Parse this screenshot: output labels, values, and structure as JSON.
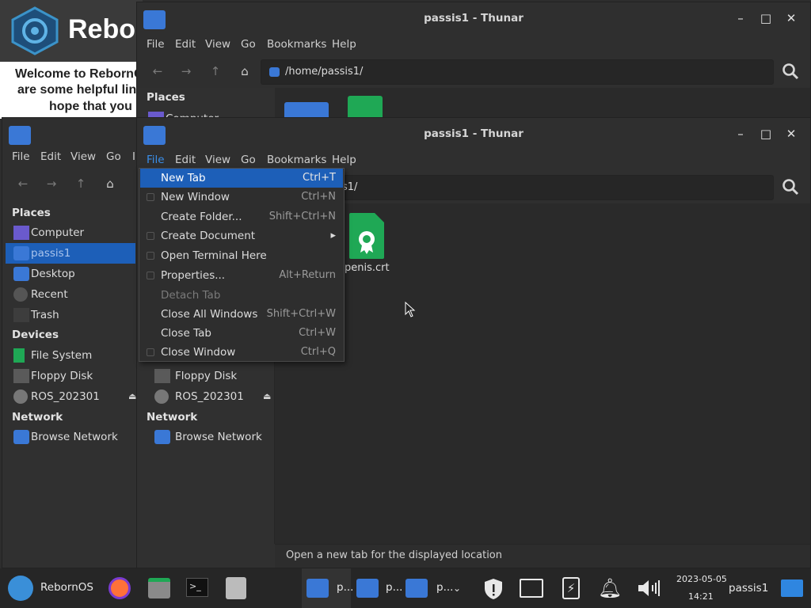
{
  "welcome": {
    "brand": "Rebor",
    "line1": "Welcome to RebornO",
    "line2": "are some helpful links",
    "line3": "hope that you e"
  },
  "back_window": {
    "title": "passis1 - Thunar",
    "menu": [
      "File",
      "Edit",
      "View",
      "Go",
      "Bookmarks",
      "Help"
    ],
    "path": "/home/passis1/",
    "places_label": "Places",
    "first_place": "Computer"
  },
  "left_window": {
    "menu": [
      "File",
      "Edit",
      "View",
      "Go",
      "I"
    ],
    "places_label": "Places",
    "places": [
      "Computer",
      "passis1",
      "Desktop",
      "Recent",
      "Trash"
    ],
    "devices_label": "Devices",
    "devices": [
      "File System",
      "Floppy Disk",
      "ROS_202301"
    ],
    "network_label": "Network",
    "network": [
      "Browse Network"
    ]
  },
  "front_window": {
    "title": "passis1 - Thunar",
    "menu": [
      "File",
      "Edit",
      "View",
      "Go",
      "Bookmarks",
      "Help"
    ],
    "path_visible": "s1/",
    "devices_visible": [
      "Floppy Disk",
      "ROS_202301"
    ],
    "network_label": "Network",
    "network": [
      "Browse Network"
    ],
    "files": [
      {
        "name": "penis.crt",
        "type": "certificate"
      }
    ],
    "status": "Open a new tab for the displayed location"
  },
  "file_menu": {
    "items": [
      {
        "label": "New Tab",
        "shortcut": "Ctrl+T",
        "state": "active"
      },
      {
        "label": "New Window",
        "shortcut": "Ctrl+N",
        "state": "normal"
      },
      {
        "label": "Create Folder...",
        "shortcut": "Shift+Ctrl+N",
        "state": "normal"
      },
      {
        "label": "Create Document",
        "shortcut": "▸",
        "state": "normal"
      },
      {
        "label": "Open Terminal Here",
        "shortcut": "",
        "state": "normal"
      },
      {
        "label": "Properties...",
        "shortcut": "Alt+Return",
        "state": "normal"
      },
      {
        "label": "Detach Tab",
        "shortcut": "",
        "state": "disabled"
      },
      {
        "label": "Close All Windows",
        "shortcut": "Shift+Ctrl+W",
        "state": "normal"
      },
      {
        "label": "Close Tab",
        "shortcut": "Ctrl+W",
        "state": "normal"
      },
      {
        "label": "Close Window",
        "shortcut": "Ctrl+Q",
        "state": "normal"
      }
    ]
  },
  "taskbar": {
    "start_label": "RebornOS",
    "window_buttons": [
      "p...",
      "p...",
      "p..."
    ],
    "date": "2023-05-05",
    "time": "14:21",
    "user": "passis1"
  },
  "colors": {
    "accent": "#1d5fb8",
    "folder": "#3a78d6",
    "cert_green": "#1fa855",
    "window_bg": "#303030",
    "content_bg": "#2a2a2a",
    "taskbar_bg": "#262626"
  }
}
